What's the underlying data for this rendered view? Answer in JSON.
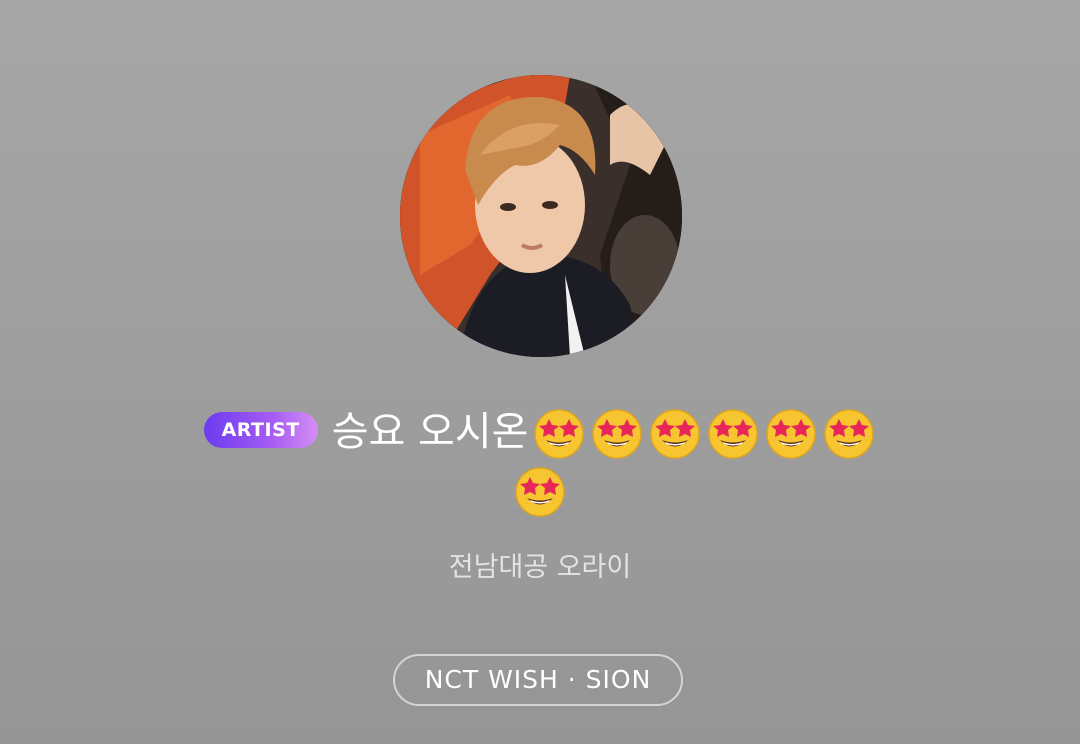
{
  "profile": {
    "avatar_alt": "profile photo",
    "badge": "ARTIST",
    "name": "승요 오시온",
    "name_emoji_count": 7,
    "name_emoji": "star-struck-emoji",
    "subtitle": "전남대공 오라이",
    "group_chip": "NCT WISH · SION"
  },
  "colors": {
    "background": "#a0a0a0",
    "badge_start": "#6b3cf0",
    "badge_end": "#d58ff5",
    "text_primary": "#ffffff",
    "text_secondary": "#e3e3e3",
    "chip_border": "#d4d4d4"
  }
}
